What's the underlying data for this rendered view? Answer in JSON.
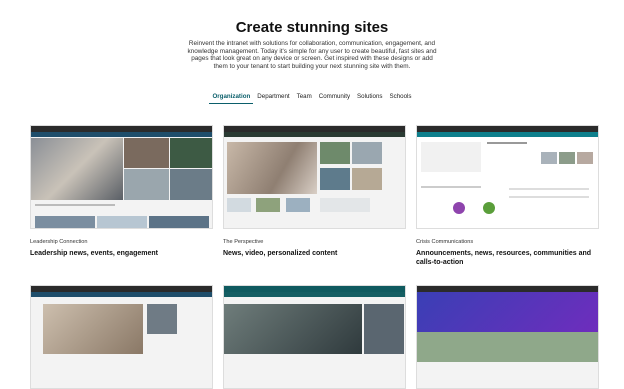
{
  "page": {
    "title": "Create stunning sites",
    "intro": "Reinvent the intranet with solutions for collaboration, communication, engagement, and knowledge management. Today it's simple for any user to create beautiful, fast sites and pages that look great on any device or screen. Get inspired with these designs or add them to your tenant to start building your next stunning site with them."
  },
  "tabs": [
    {
      "label": "Organization",
      "active": true
    },
    {
      "label": "Department",
      "active": false
    },
    {
      "label": "Team",
      "active": false
    },
    {
      "label": "Community",
      "active": false
    },
    {
      "label": "Solutions",
      "active": false
    },
    {
      "label": "Schools",
      "active": false
    }
  ],
  "cards": [
    {
      "category": "Leadership Connection",
      "headline": "Leadership news, events, engagement"
    },
    {
      "category": "The Perspective",
      "headline": "News, video, personalized content"
    },
    {
      "category": "Crisis Communications",
      "headline": "Announcements, news, resources, communities and calls-to-action"
    },
    {
      "category": "",
      "headline": ""
    },
    {
      "category": "",
      "headline": ""
    },
    {
      "category": "",
      "headline": ""
    }
  ],
  "colors": {
    "accent": "#0b5f6b",
    "suite_bar": "#2b2b2b",
    "nav_bar": "#0c3c5a"
  }
}
